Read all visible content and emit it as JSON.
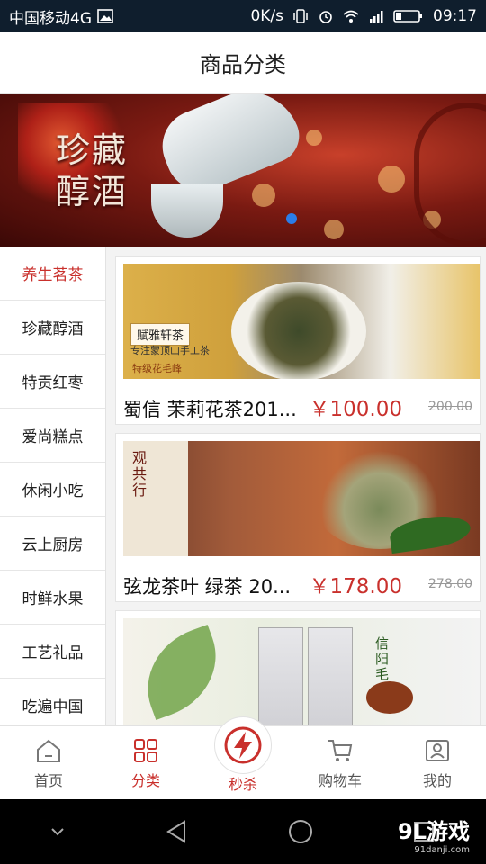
{
  "status_bar": {
    "carrier": "中国移动4G",
    "speed": "0K/s",
    "time": "09:17"
  },
  "header": {
    "title": "商品分类"
  },
  "banner": {
    "title_line1": "珍藏",
    "title_line2": "醇酒"
  },
  "sidebar": {
    "items": [
      {
        "label": "养生茗茶",
        "active": true
      },
      {
        "label": "珍藏醇酒"
      },
      {
        "label": "特贡红枣"
      },
      {
        "label": "爱尚糕点"
      },
      {
        "label": "休闲小吃"
      },
      {
        "label": "云上厨房"
      },
      {
        "label": "时鲜水果"
      },
      {
        "label": "工艺礼品"
      },
      {
        "label": "吃遍中国"
      }
    ]
  },
  "products": [
    {
      "name": "蜀信 茉莉花茶201...",
      "price": "￥100.00",
      "old_price": "200.00",
      "img_labels": [
        "赋雅轩茶",
        "专注蒙顶山手工茶",
        "特级花毛峰"
      ]
    },
    {
      "name": "弦龙茶叶 绿茶 20...",
      "price": "￥178.00",
      "old_price": "278.00",
      "img_labels": [
        "观共行"
      ]
    },
    {
      "name": "",
      "price": "",
      "old_price": "",
      "img_labels": [
        "信阳毛尖"
      ]
    }
  ],
  "bottom_nav": {
    "items": [
      {
        "label": "首页",
        "icon": "home-icon"
      },
      {
        "label": "分类",
        "icon": "grid-icon",
        "active": true
      },
      {
        "label": "秒杀",
        "icon": "flash-icon"
      },
      {
        "label": "购物车",
        "icon": "cart-icon"
      },
      {
        "label": "我的",
        "icon": "profile-icon"
      }
    ]
  },
  "watermark": {
    "brand": "9L游戏",
    "site": "91danji.com"
  },
  "colors": {
    "accent": "#c9302c",
    "statusbar": "#0f1e2d",
    "dot": "#2b7de9"
  }
}
